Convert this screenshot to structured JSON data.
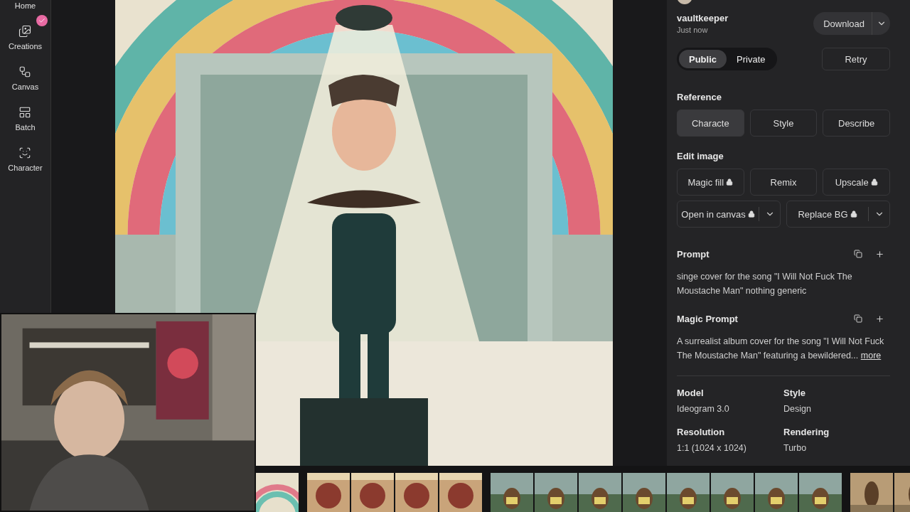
{
  "sidebar": {
    "items": [
      {
        "label": "Home",
        "badge": false
      },
      {
        "label": "Creations",
        "badge": true
      },
      {
        "label": "Canvas",
        "badge": false
      },
      {
        "label": "Batch",
        "badge": false
      },
      {
        "label": "Character",
        "badge": false
      }
    ]
  },
  "panel": {
    "user": {
      "name": "vaultkeeper",
      "time": "Just now"
    },
    "download": {
      "label": "Download"
    },
    "visibility": [
      {
        "label": "Public",
        "selected": true
      },
      {
        "label": "Private",
        "selected": false
      }
    ],
    "retry": {
      "label": "Retry"
    },
    "reference": {
      "title": "Reference",
      "buttons": [
        {
          "label": "Characte",
          "selected": true
        },
        {
          "label": "Style",
          "selected": false
        },
        {
          "label": "Describe",
          "selected": false
        }
      ]
    },
    "edit": {
      "title": "Edit image",
      "buttons": [
        {
          "label": "Magic fill",
          "locked": true,
          "dropdown": false
        },
        {
          "label": "Remix",
          "locked": false,
          "dropdown": false
        },
        {
          "label": "Upscale",
          "locked": true,
          "dropdown": false
        },
        {
          "label": "Open in canvas",
          "locked": true,
          "dropdown": true
        },
        {
          "label": "Replace BG",
          "locked": true,
          "dropdown": true
        }
      ]
    },
    "prompt": {
      "title": "Prompt",
      "text": "singe cover for the song \"I Will Not Fuck The Moustache Man\" nothing generic"
    },
    "magic_prompt": {
      "title": "Magic Prompt",
      "text": "A surrealist album cover for the song \"I Will Not Fuck The Moustache Man\" featuring a bewildered...",
      "link": "more"
    },
    "details": [
      {
        "label": "Model",
        "value": "Ideogram 3.0"
      },
      {
        "label": "Style",
        "value": "Design"
      },
      {
        "label": "Resolution",
        "value": "1:1 (1024 x 1024)"
      },
      {
        "label": "Rendering",
        "value": "Turbo"
      }
    ]
  },
  "thumbnails": [
    {
      "kind": "rainbow"
    },
    {
      "kind": "love"
    },
    {
      "kind": "love"
    },
    {
      "kind": "love"
    },
    {
      "kind": "love"
    },
    {
      "kind": "bear"
    },
    {
      "kind": "bear"
    },
    {
      "kind": "bear"
    },
    {
      "kind": "bear"
    },
    {
      "kind": "bear"
    },
    {
      "kind": "bear"
    },
    {
      "kind": "bear"
    },
    {
      "kind": "bear"
    },
    {
      "kind": "walker"
    },
    {
      "kind": "walker"
    }
  ]
}
